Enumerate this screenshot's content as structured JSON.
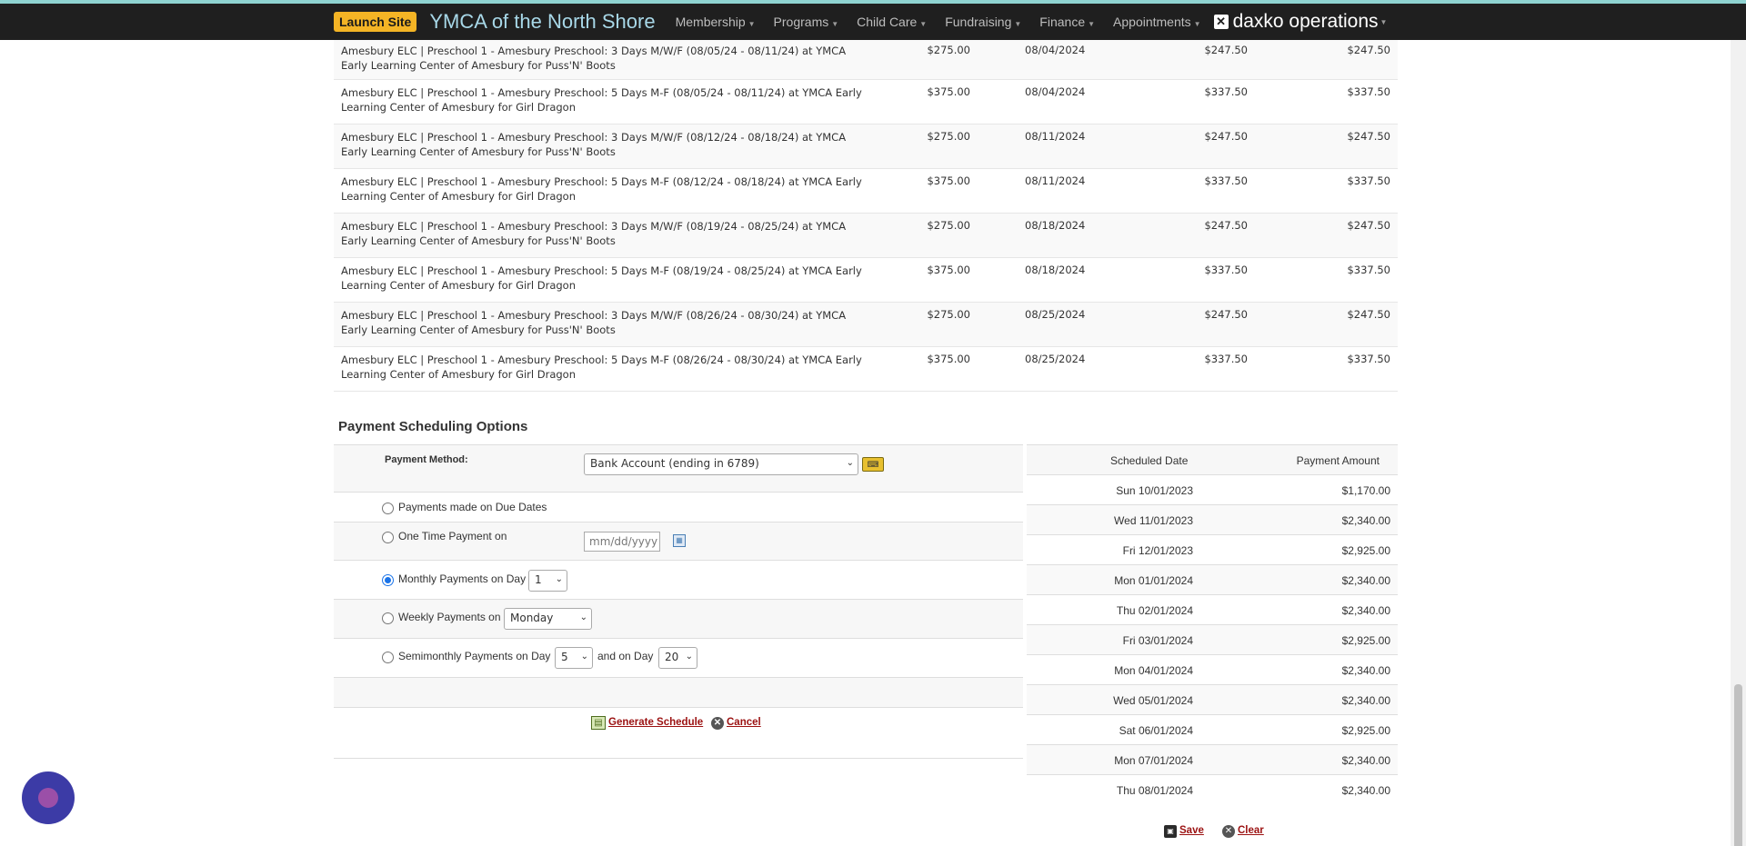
{
  "topbar": {
    "launch_label": "Launch Site",
    "site_title": "YMCA of the North Shore",
    "nav": [
      "Membership",
      "Programs",
      "Child Care",
      "Fundraising",
      "Finance",
      "Appointments"
    ],
    "brand": "daxko operations",
    "colors": {
      "bar": "#1f1f1f",
      "accent": "#8fd3d1",
      "launch": "#f4b425"
    }
  },
  "line_items": [
    {
      "desc": "Amesbury ELC | Preschool 1 - Amesbury Preschool: 3 Days M/W/F (08/05/24 - 08/11/24) at YMCA Early Learning Center of Amesbury for Puss'N' Boots",
      "price": "$275.00",
      "date": "08/04/2024",
      "amount": "$247.50",
      "balance": "$247.50"
    },
    {
      "desc": "Amesbury ELC | Preschool 1 - Amesbury Preschool: 5 Days M-F (08/05/24 - 08/11/24) at YMCA Early Learning Center of Amesbury for Girl Dragon",
      "price": "$375.00",
      "date": "08/04/2024",
      "amount": "$337.50",
      "balance": "$337.50"
    },
    {
      "desc": "Amesbury ELC | Preschool 1 - Amesbury Preschool: 3 Days M/W/F (08/12/24 - 08/18/24) at YMCA Early Learning Center of Amesbury for Puss'N' Boots",
      "price": "$275.00",
      "date": "08/11/2024",
      "amount": "$247.50",
      "balance": "$247.50"
    },
    {
      "desc": "Amesbury ELC | Preschool 1 - Amesbury Preschool: 5 Days M-F (08/12/24 - 08/18/24) at YMCA Early Learning Center of Amesbury for Girl Dragon",
      "price": "$375.00",
      "date": "08/11/2024",
      "amount": "$337.50",
      "balance": "$337.50"
    },
    {
      "desc": "Amesbury ELC | Preschool 1 - Amesbury Preschool: 3 Days M/W/F (08/19/24 - 08/25/24) at YMCA Early Learning Center of Amesbury for Puss'N' Boots",
      "price": "$275.00",
      "date": "08/18/2024",
      "amount": "$247.50",
      "balance": "$247.50"
    },
    {
      "desc": "Amesbury ELC | Preschool 1 - Amesbury Preschool: 5 Days M-F (08/19/24 - 08/25/24) at YMCA Early Learning Center of Amesbury for Girl Dragon",
      "price": "$375.00",
      "date": "08/18/2024",
      "amount": "$337.50",
      "balance": "$337.50"
    },
    {
      "desc": "Amesbury ELC | Preschool 1 - Amesbury Preschool: 3 Days M/W/F (08/26/24 - 08/30/24) at YMCA Early Learning Center of Amesbury for Puss'N' Boots",
      "price": "$275.00",
      "date": "08/25/2024",
      "amount": "$247.50",
      "balance": "$247.50"
    },
    {
      "desc": "Amesbury ELC | Preschool 1 - Amesbury Preschool: 5 Days M-F (08/26/24 - 08/30/24) at YMCA Early Learning Center of Amesbury for Girl Dragon",
      "price": "$375.00",
      "date": "08/25/2024",
      "amount": "$337.50",
      "balance": "$337.50"
    }
  ],
  "payment_options": {
    "title": "Payment Scheduling Options",
    "method_label": "Payment Method:",
    "method_value": "Bank Account (ending in 6789)",
    "due_dates_label": "Payments made on Due Dates",
    "one_time_label": "One Time Payment on",
    "one_time_placeholder": "mm/dd/yyyy",
    "monthly_label": "Monthly Payments on Day",
    "monthly_day": "1",
    "weekly_label": "Weekly Payments on",
    "weekly_day": "Monday",
    "semi_label": "Semimonthly Payments on Day",
    "semi_day1": "5",
    "semi_and": "and on Day",
    "semi_day2": "20",
    "selected": "monthly",
    "generate_label": "Generate Schedule",
    "cancel_label": "Cancel"
  },
  "schedule": {
    "header_date": "Scheduled Date",
    "header_amount": "Payment Amount",
    "rows": [
      {
        "date": "Sun 10/01/2023",
        "amount": "$1,170.00"
      },
      {
        "date": "Wed 11/01/2023",
        "amount": "$2,340.00"
      },
      {
        "date": "Fri 12/01/2023",
        "amount": "$2,925.00"
      },
      {
        "date": "Mon 01/01/2024",
        "amount": "$2,340.00"
      },
      {
        "date": "Thu 02/01/2024",
        "amount": "$2,340.00"
      },
      {
        "date": "Fri 03/01/2024",
        "amount": "$2,925.00"
      },
      {
        "date": "Mon 04/01/2024",
        "amount": "$2,340.00"
      },
      {
        "date": "Wed 05/01/2024",
        "amount": "$2,340.00"
      },
      {
        "date": "Sat 06/01/2024",
        "amount": "$2,925.00"
      },
      {
        "date": "Mon 07/01/2024",
        "amount": "$2,340.00"
      },
      {
        "date": "Thu 08/01/2024",
        "amount": "$2,340.00"
      }
    ]
  },
  "footer_actions": {
    "save_label": "Save",
    "clear_label": "Clear"
  }
}
